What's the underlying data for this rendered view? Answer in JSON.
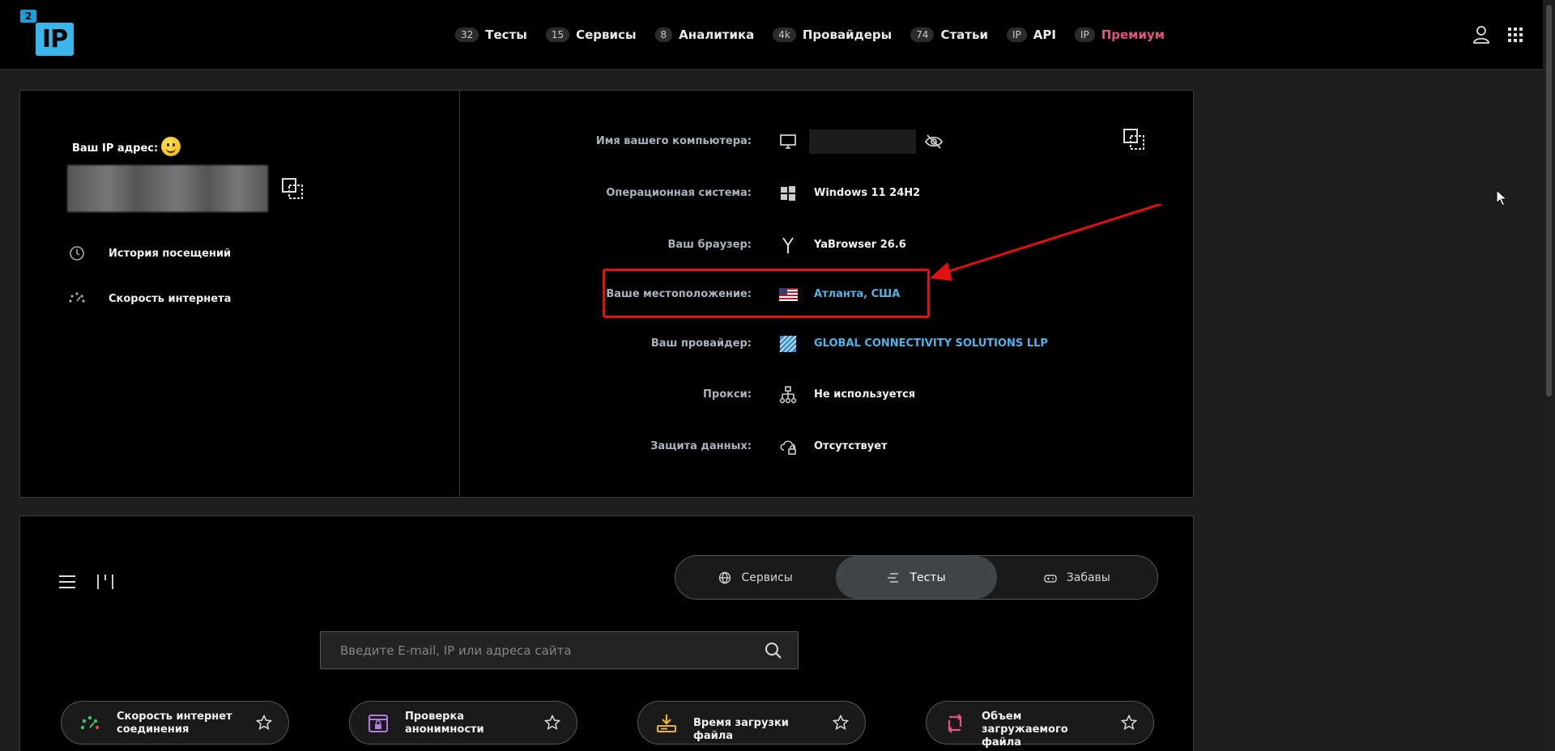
{
  "header": {
    "logo_badge": "2",
    "logo_text": "IP",
    "nav": [
      {
        "count": "32",
        "label": "Тесты"
      },
      {
        "count": "15",
        "label": "Сервисы"
      },
      {
        "count": "8",
        "label": "Аналитика"
      },
      {
        "count": "4k",
        "label": "Провайдеры"
      },
      {
        "count": "74",
        "label": "Статьи"
      },
      {
        "count": "IP",
        "label": "API"
      },
      {
        "count": "IP",
        "label": "Премиум"
      }
    ]
  },
  "ip_panel": {
    "label": "Ваш IP адрес:",
    "links": [
      {
        "label": "История посещений"
      },
      {
        "label": "Скорость интернета"
      }
    ]
  },
  "info": {
    "rows": [
      {
        "label": "Имя вашего компьютера:",
        "value": ""
      },
      {
        "label": "Операционная система:",
        "value": "Windows 11 24H2"
      },
      {
        "label": "Ваш браузер:",
        "value": "YaBrowser 26.6"
      },
      {
        "label": "Ваше местоположение:",
        "value": "Атланта, США"
      },
      {
        "label": "Ваш провайдер:",
        "value": "GLOBAL CONNECTIVITY SOLUTIONS LLP"
      },
      {
        "label": "Прокси:",
        "value": "Не используется"
      },
      {
        "label": "Защита данных:",
        "value": "Отсутствует"
      }
    ],
    "colors": {
      "highlight": "#e21010",
      "link": "#4fb3e8"
    }
  },
  "tools": {
    "tabs": [
      {
        "label": "Сервисы",
        "icon": "globe-icon"
      },
      {
        "label": "Тесты",
        "icon": "list-icon",
        "active": true
      },
      {
        "label": "Забавы",
        "icon": "gamepad-icon"
      }
    ],
    "search": {
      "placeholder": "Введите E-mail, IP или адреса сайта"
    },
    "cards": [
      {
        "label": "Скорость интернет соединения",
        "icon": "speedometer-icon"
      },
      {
        "label": "Проверка анонимности",
        "icon": "anonymity-icon"
      },
      {
        "label": "Время загрузки файла",
        "icon": "download-icon"
      },
      {
        "label": "Объем загружаемого файла",
        "icon": "file-size-icon"
      }
    ]
  }
}
